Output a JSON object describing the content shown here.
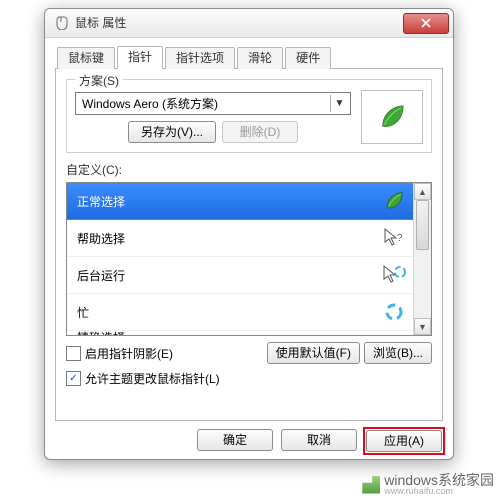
{
  "window": {
    "title": "鼠标 属性"
  },
  "tabs": {
    "items": [
      {
        "label": "鼠标键"
      },
      {
        "label": "指针"
      },
      {
        "label": "指针选项"
      },
      {
        "label": "滑轮"
      },
      {
        "label": "硬件"
      }
    ],
    "active_index": 1
  },
  "scheme": {
    "group_label": "方案(S)",
    "selected": "Windows Aero (系统方案)",
    "save_as": "另存为(V)...",
    "delete": "删除(D)"
  },
  "customize": {
    "label": "自定义(C):",
    "items": [
      {
        "name": "正常选择",
        "icon": "leaf"
      },
      {
        "name": "帮助选择",
        "icon": "arrow-help"
      },
      {
        "name": "后台运行",
        "icon": "arrow-busy"
      },
      {
        "name": "忙",
        "icon": "busy-ring"
      }
    ],
    "partial_next": "精确选择",
    "selected_index": 0
  },
  "options": {
    "shadow": {
      "label": "启用指针阴影(E)",
      "checked": false
    },
    "theme_change": {
      "label": "允许主题更改鼠标指针(L)",
      "checked": true
    },
    "use_default": "使用默认值(F)",
    "browse": "浏览(B)..."
  },
  "buttons": {
    "ok": "确定",
    "cancel": "取消",
    "apply": "应用(A)"
  },
  "watermark": {
    "text": "windows系统家园",
    "url": "www.ruhaifu.com"
  }
}
